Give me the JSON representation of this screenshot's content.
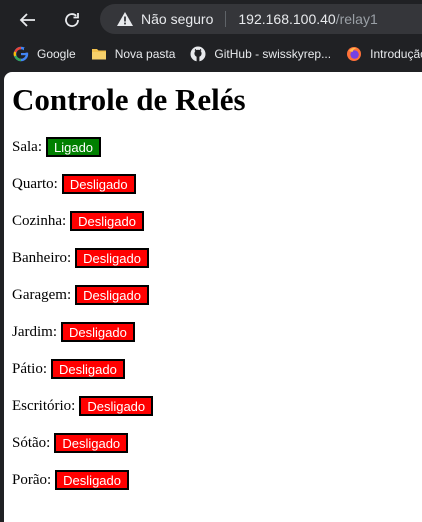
{
  "browser": {
    "security_label": "Não seguro",
    "url_host": "192.168.100.40",
    "url_path": "/relay1",
    "bookmarks": [
      {
        "label": "Google",
        "icon": "google-icon"
      },
      {
        "label": "Nova pasta",
        "icon": "folder-icon"
      },
      {
        "label": "GitHub - swisskyrep...",
        "icon": "github-icon"
      },
      {
        "label": "Introdução",
        "icon": "firefox-icon"
      }
    ]
  },
  "page": {
    "title": "Controle de Relés",
    "relays": [
      {
        "name": "Sala:",
        "state": "Ligado",
        "on": true
      },
      {
        "name": "Quarto:",
        "state": "Desligado",
        "on": false
      },
      {
        "name": "Cozinha:",
        "state": "Desligado",
        "on": false
      },
      {
        "name": "Banheiro:",
        "state": "Desligado",
        "on": false
      },
      {
        "name": "Garagem:",
        "state": "Desligado",
        "on": false
      },
      {
        "name": "Jardim:",
        "state": "Desligado",
        "on": false
      },
      {
        "name": "Pátio:",
        "state": "Desligado",
        "on": false
      },
      {
        "name": "Escritório:",
        "state": "Desligado",
        "on": false
      },
      {
        "name": "Sótão:",
        "state": "Desligado",
        "on": false
      },
      {
        "name": "Porão:",
        "state": "Desligado",
        "on": false
      }
    ]
  },
  "colors": {
    "on": "#008000",
    "off": "#ff0000",
    "browser_bg": "#202124"
  }
}
